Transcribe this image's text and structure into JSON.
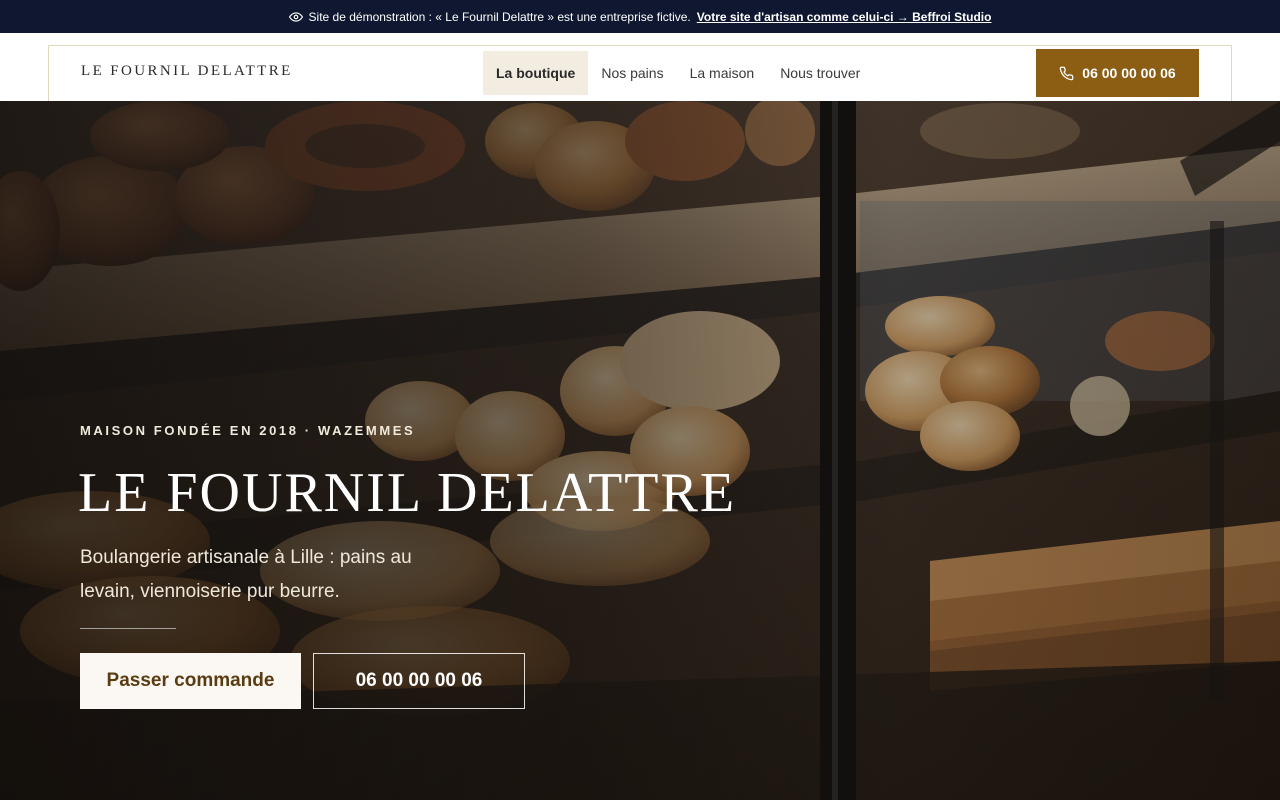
{
  "demo_banner": {
    "icon": "eye-icon",
    "text": "Site de démonstration : « Le Fournil Delattre » est une entreprise fictive.",
    "link": "Votre site d'artisan comme celui-ci → Beffroi Studio"
  },
  "header": {
    "logo": "LE FOURNIL DELATTRE",
    "nav": [
      {
        "label": "La boutique",
        "active": true
      },
      {
        "label": "Nos pains",
        "active": false
      },
      {
        "label": "La maison",
        "active": false
      },
      {
        "label": "Nous trouver",
        "active": false
      }
    ],
    "call_button": {
      "icon": "phone-icon",
      "label": "06 00 00 00 06"
    }
  },
  "hero": {
    "eyebrow": "MAISON FONDÉE EN 2018 · WAZEMMES",
    "title": "LE FOURNIL DELATTRE",
    "subtitle": "Boulangerie artisanale à Lille : pains au levain, viennoiserie pur beurre.",
    "primary_button": "Passer commande",
    "secondary_button": "06 00 00 00 06"
  },
  "colors": {
    "banner_bg": "#0f1830",
    "accent_brown": "#8b5e13",
    "nav_active_bg": "#f3ece1",
    "header_border": "#e2d6bf"
  }
}
